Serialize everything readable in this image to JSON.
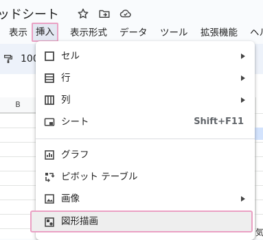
{
  "window": {
    "doc_title": "ッドシート"
  },
  "menubar": {
    "items": [
      "表示",
      "挿入",
      "表示形式",
      "データ",
      "ツール",
      "拡張機能",
      "ヘル"
    ],
    "active": "挿入"
  },
  "toolbar": {
    "zoom": "100"
  },
  "grid": {
    "column_b": "B",
    "peek_text": "気"
  },
  "insert_menu": {
    "items": [
      {
        "label": "セル",
        "icon": "cell-square-icon",
        "submenu": true
      },
      {
        "label": "行",
        "icon": "rows-icon",
        "submenu": true
      },
      {
        "label": "列",
        "icon": "columns-icon",
        "submenu": true
      },
      {
        "label": "シート",
        "icon": "sheet-tab-icon",
        "shortcut": "Shift+F11"
      },
      {
        "label": "グラフ",
        "icon": "chart-icon"
      },
      {
        "label": "ピボット テーブル",
        "icon": "pivot-table-icon"
      },
      {
        "label": "画像",
        "icon": "image-icon",
        "submenu": true
      },
      {
        "label": "図形描画",
        "icon": "drawing-icon",
        "highlighted": true
      }
    ]
  },
  "colors": {
    "highlight_border": "#ea9fc3",
    "active_menu_bg": "#e3e8f2",
    "toolbar_bg": "#edf2fa"
  }
}
